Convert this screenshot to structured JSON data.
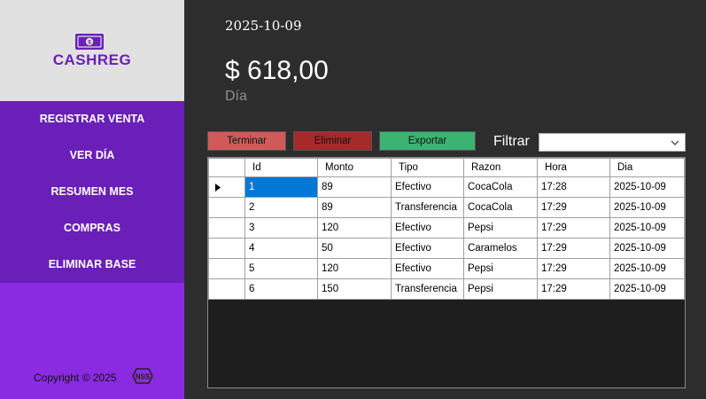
{
  "app": {
    "logo_text": "CASHREG",
    "logo_icon": "money-bill-icon",
    "accent_color": "#6a1fb8"
  },
  "sidebar": {
    "items": [
      {
        "label": "REGISTRAR VENTA"
      },
      {
        "label": "VER DÍA"
      },
      {
        "label": "RESUMEN MES"
      },
      {
        "label": "COMPRAS"
      },
      {
        "label": "ELIMINAR BASE"
      }
    ],
    "copyright": "Copyright ©  2025",
    "brand_icon": "nss-logo-icon"
  },
  "header": {
    "date": "2025-10-09",
    "amount": "$ 618,00",
    "period": "Día"
  },
  "toolbar": {
    "terminar_label": "Terminar",
    "eliminar_label": "Eliminar",
    "exportar_label": "Exportar",
    "filter_label": "Filtrar",
    "filter_value": "",
    "colors": {
      "terminar": "#d05a5a",
      "eliminar": "#a52a2a",
      "exportar": "#3cb371"
    }
  },
  "table": {
    "columns": [
      "Id",
      "Monto",
      "Tipo",
      "Razon",
      "Hora",
      "Dia"
    ],
    "rows": [
      [
        "1",
        "89",
        "Efectivo",
        "CocaCola",
        "17:28",
        "2025-10-09"
      ],
      [
        "2",
        "89",
        "Transferencia",
        "CocaCola",
        "17:29",
        "2025-10-09"
      ],
      [
        "3",
        "120",
        "Efectivo",
        "Pepsi",
        "17:29",
        "2025-10-09"
      ],
      [
        "4",
        "50",
        "Efectivo",
        "Caramelos",
        "17:29",
        "2025-10-09"
      ],
      [
        "5",
        "120",
        "Efectivo",
        "Pepsi",
        "17:29",
        "2025-10-09"
      ],
      [
        "6",
        "150",
        "Transferencia",
        "Pepsi",
        "17:29",
        "2025-10-09"
      ]
    ]
  }
}
